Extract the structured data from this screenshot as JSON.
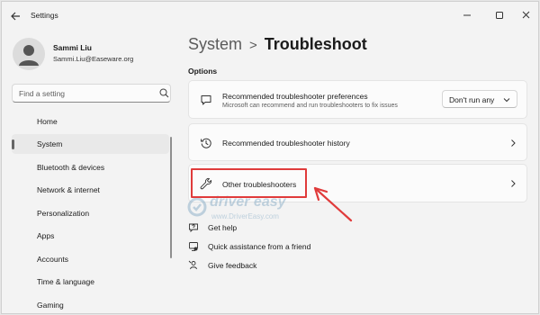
{
  "window": {
    "title": "Settings"
  },
  "profile": {
    "name": "Sammi Liu",
    "email": "Sammi.Liu@Easeware.org"
  },
  "search": {
    "placeholder": "Find a setting"
  },
  "sidebar": {
    "items": [
      {
        "label": "Home",
        "active": false
      },
      {
        "label": "System",
        "active": true
      },
      {
        "label": "Bluetooth & devices",
        "active": false
      },
      {
        "label": "Network & internet",
        "active": false
      },
      {
        "label": "Personalization",
        "active": false
      },
      {
        "label": "Apps",
        "active": false
      },
      {
        "label": "Accounts",
        "active": false
      },
      {
        "label": "Time & language",
        "active": false
      },
      {
        "label": "Gaming",
        "active": false
      }
    ]
  },
  "breadcrumb": {
    "parent": "System",
    "separator": ">",
    "current": "Troubleshoot"
  },
  "main": {
    "section_label": "Options",
    "cards": [
      {
        "title": "Recommended troubleshooter preferences",
        "subtitle": "Microsoft can recommend and run troubleshooters to fix issues",
        "icon": "chat-bubble-icon",
        "dropdown_value": "Don't run any"
      },
      {
        "title": "Recommended troubleshooter history",
        "icon": "history-icon"
      },
      {
        "title": "Other troubleshooters",
        "icon": "wrench-icon"
      }
    ],
    "help_links": [
      {
        "label": "Get help",
        "icon": "help-icon"
      },
      {
        "label": "Quick assistance from a friend",
        "icon": "remote-assist-icon"
      },
      {
        "label": "Give feedback",
        "icon": "feedback-icon"
      }
    ]
  },
  "watermark": {
    "brand": "driver easy",
    "url": "www.DriverEasy.com"
  },
  "colors": {
    "window_bg": "#f3f3f3",
    "card_bg": "#fbfbfb",
    "highlight": "#e03b3b",
    "watermark": "#5b8fb4"
  }
}
